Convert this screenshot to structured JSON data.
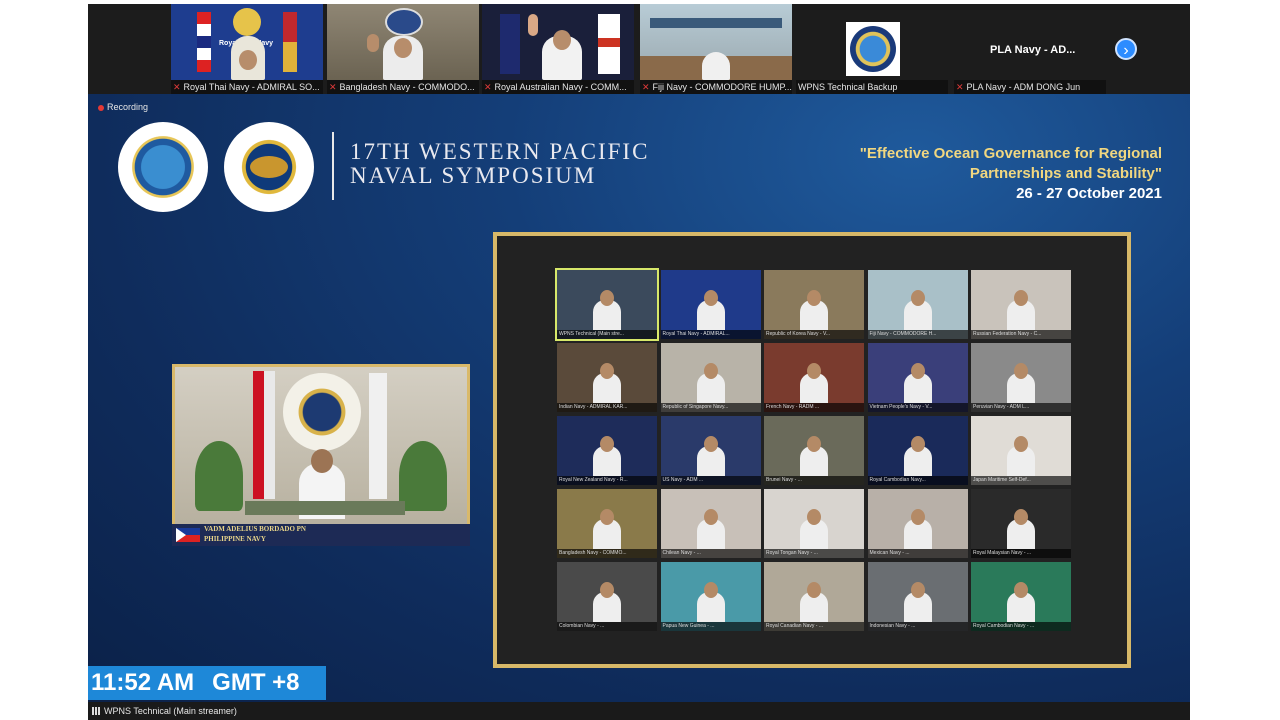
{
  "top_strip": {
    "participants": [
      {
        "label": "Royal Thai Navy - ADMIRAL SO...",
        "overlay_text": "Royal Thai Navy"
      },
      {
        "label": "Bangladesh Navy - COMMODO..."
      },
      {
        "label": "Royal Australian Navy - COMM..."
      },
      {
        "label": "Fiji Navy - COMMODORE HUMP..."
      },
      {
        "label": "WPNS Technical Backup"
      },
      {
        "label": "PLA Navy - ADM DONG Jun",
        "tile_title": "PLA Navy - AD..."
      }
    ],
    "next_icon": "chevron-right-icon"
  },
  "recording": {
    "label": "Recording"
  },
  "header": {
    "title_line1": "17TH WESTERN PACIFIC",
    "title_line2": "NAVAL SYMPOSIUM",
    "theme_line1": "\"Effective Ocean Governance for Regional",
    "theme_line2": "Partnerships and Stability\"",
    "dates": "26 - 27 October 2021",
    "seal1_text": "WESTERN PACIFIC NAVAL SYMPOSIUM",
    "seal2_top": "HUKBONG DAGAT",
    "seal2_bottom": "PILIPINAS"
  },
  "speaker": {
    "name": "VADM ADELIUS BORDADO PN",
    "org": "PHILIPPINE NAVY",
    "seal_top": "HUKBONG DAGAT",
    "seal_bottom": "PILIPINAS"
  },
  "grid": {
    "tiles": [
      {
        "label": "WPNS Technical (Main stre...",
        "bg": "#3b4a5c",
        "active": true
      },
      {
        "label": "Royal Thai Navy - ADMIRAL...",
        "bg": "#1f3a8a"
      },
      {
        "label": "Republic of Korea Navy - V...",
        "bg": "#8a7a5c"
      },
      {
        "label": "Fiji Navy - COMMODORE H...",
        "bg": "#a9c0c8"
      },
      {
        "label": "Russian Federation Navy - C...",
        "bg": "#c9c3bb"
      },
      {
        "label": "Indian Navy - ADMIRAL KAR...",
        "bg": "#5a4a3a"
      },
      {
        "label": "Republic of Singapore Navy...",
        "bg": "#b8b3a8"
      },
      {
        "label": "French Navy - RADM ...",
        "bg": "#7a3b2e"
      },
      {
        "label": "Vietnam People's Navy - V...",
        "bg": "#3a3f7a"
      },
      {
        "label": "Peruvian Navy - ADM L...",
        "bg": "#8a8a8a"
      },
      {
        "label": "Royal New Zealand Navy - R...",
        "bg": "#1e2c5a"
      },
      {
        "label": "US Navy - ADM ...",
        "bg": "#2a3a6a"
      },
      {
        "label": "Brunei Navy - ...",
        "bg": "#6a6a5a"
      },
      {
        "label": "Royal Cambodian Navy...",
        "bg": "#1a2a5a"
      },
      {
        "label": "Japan Maritime Self-Def...",
        "bg": "#e0dcd6"
      },
      {
        "label": "Bangladesh Navy - COMMO...",
        "bg": "#8a7a4a"
      },
      {
        "label": "Chilean Navy - ...",
        "bg": "#c8c0b8"
      },
      {
        "label": "Royal Tongan Navy - ...",
        "bg": "#d8d4cf"
      },
      {
        "label": "Mexican Navy - ...",
        "bg": "#b8b0a8"
      },
      {
        "label": "Royal Malaysian Navy - ...",
        "bg": "#2a2a2a"
      },
      {
        "label": "Colombian Navy - ...",
        "bg": "#4a4a4a"
      },
      {
        "label": "Papua New Guinea - ...",
        "bg": "#4a9aa8"
      },
      {
        "label": "Royal Canadian Navy - ...",
        "bg": "#b0a898"
      },
      {
        "label": "Indonesian Navy - ...",
        "bg": "#6a6e72"
      },
      {
        "label": "Royal Cambodian Navy - ...",
        "bg": "#2a7a5a"
      }
    ]
  },
  "clock": {
    "time": "11:52 AM",
    "tz": "GMT +8"
  },
  "bottom": {
    "speaker_label": "WPNS Technical (Main streamer)"
  },
  "colors": {
    "gold": "#d7b868",
    "zoom_blue": "#2d8cff",
    "clock_bg": "#1e88d8"
  }
}
